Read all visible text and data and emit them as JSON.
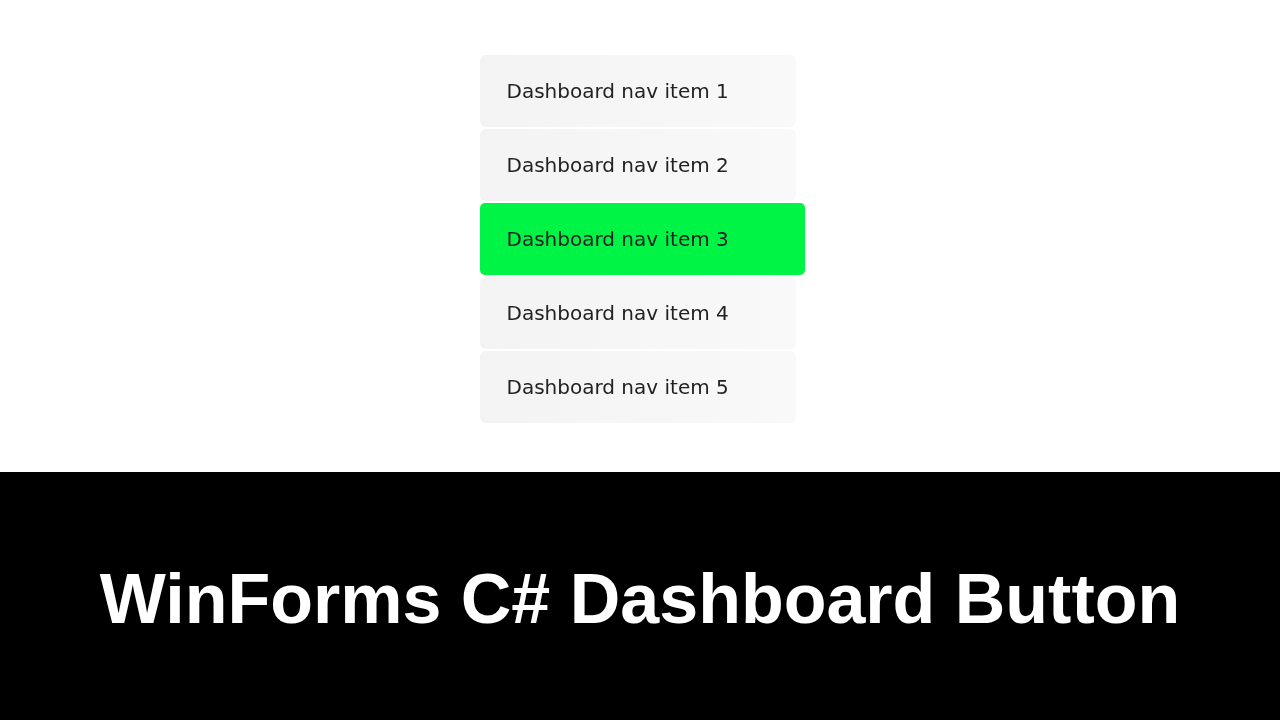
{
  "nav_items": [
    {
      "label": "Dashboard nav item 1",
      "selected": false
    },
    {
      "label": "Dashboard nav item 2",
      "selected": false
    },
    {
      "label": "Dashboard nav item 3",
      "selected": true
    },
    {
      "label": "Dashboard nav item 4",
      "selected": false
    },
    {
      "label": "Dashboard nav item 5",
      "selected": false
    }
  ],
  "banner": {
    "title": "WinForms C# Dashboard Button"
  }
}
